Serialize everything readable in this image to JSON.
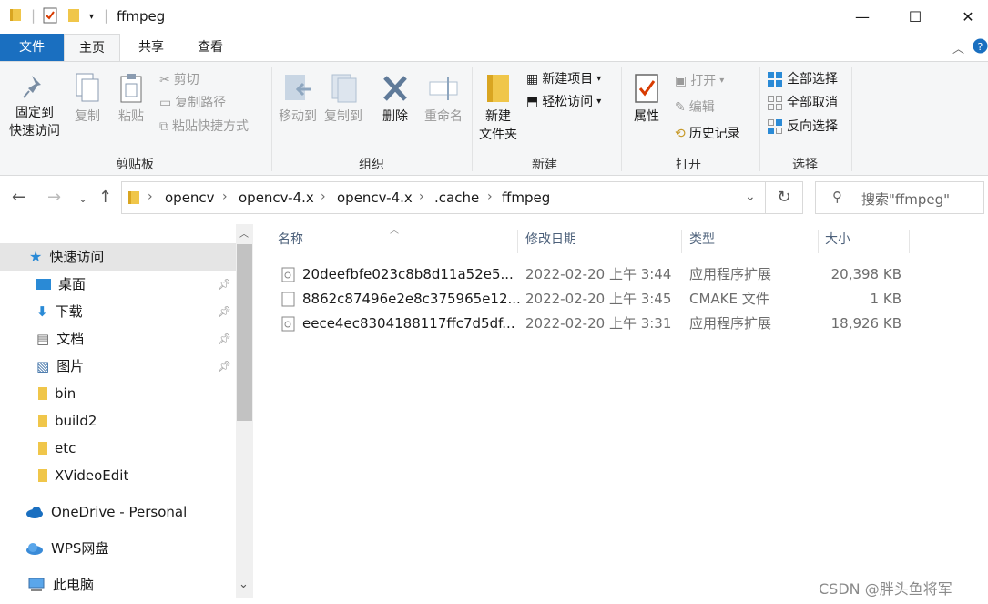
{
  "window": {
    "title": "ffmpeg",
    "minimize": "—",
    "maximize": "☐",
    "close": "✕"
  },
  "ribbon_tabs": [
    "文件",
    "主页",
    "共享",
    "查看"
  ],
  "ribbon": {
    "clipboard": {
      "label": "剪贴板",
      "pin_line1": "固定到",
      "pin_line2": "快速访问",
      "copy": "复制",
      "paste": "粘贴",
      "cut": "剪切",
      "copy_path": "复制路径",
      "paste_shortcut": "粘贴快捷方式"
    },
    "organize": {
      "label": "组织",
      "move_to": "移动到",
      "copy_to": "复制到",
      "delete": "删除",
      "rename": "重命名"
    },
    "new": {
      "label": "新建",
      "new_folder_line1": "新建",
      "new_folder_line2": "文件夹",
      "new_item": "新建项目",
      "easy_access": "轻松访问"
    },
    "open": {
      "label": "打开",
      "properties": "属性",
      "open": "打开",
      "edit": "编辑",
      "history": "历史记录"
    },
    "select": {
      "label": "选择",
      "select_all": "全部选择",
      "select_none": "全部取消",
      "invert": "反向选择"
    }
  },
  "address": {
    "crumbs": [
      "opencv",
      "opencv-4.x",
      "opencv-4.x",
      ".cache",
      "ffmpeg"
    ],
    "search_placeholder": "搜索\"ffmpeg\""
  },
  "nav_pane": {
    "quick_access": "快速访问",
    "items": [
      "桌面",
      "下载",
      "文档",
      "图片",
      "bin",
      "build2",
      "etc",
      "XVideoEdit"
    ],
    "onedrive": "OneDrive - Personal",
    "wps": "WPS网盘",
    "this_pc": "此电脑"
  },
  "columns": [
    "名称",
    "修改日期",
    "类型",
    "大小"
  ],
  "files": [
    {
      "name": "20deefbfe023c8b8d11a52e5...",
      "date": "2022-02-20 上午 3:44",
      "type": "应用程序扩展",
      "size": "20,398 KB"
    },
    {
      "name": "8862c87496e2e8c375965e12...",
      "date": "2022-02-20 上午 3:45",
      "type": "CMAKE 文件",
      "size": "1 KB"
    },
    {
      "name": "eece4ec8304188117ffc7d5df...",
      "date": "2022-02-20 上午 3:31",
      "type": "应用程序扩展",
      "size": "18,926 KB"
    }
  ],
  "watermark": "CSDN @胖头鱼将军"
}
